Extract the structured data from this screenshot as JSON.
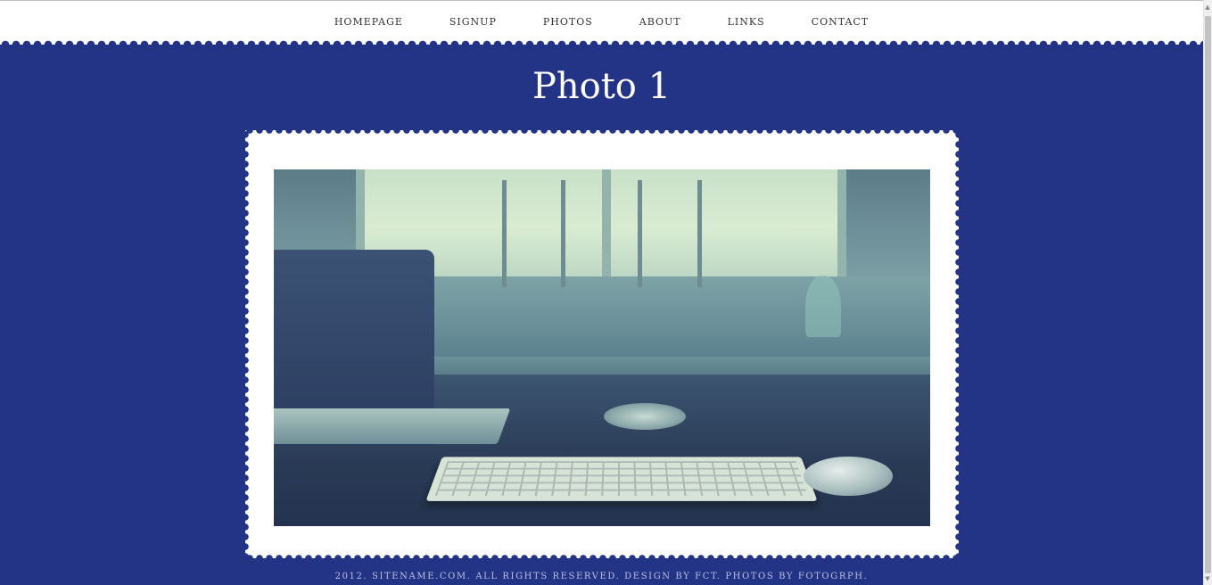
{
  "nav": {
    "items": [
      {
        "label": "HOMEPAGE"
      },
      {
        "label": "SIGNUP"
      },
      {
        "label": "PHOTOS"
      },
      {
        "label": "ABOUT"
      },
      {
        "label": "LINKS"
      },
      {
        "label": "CONTACT"
      }
    ]
  },
  "page": {
    "title": "Photo 1"
  },
  "photo": {
    "icon": "photo-image",
    "subject": "desk with laptop, keyboard and mouse"
  },
  "footer": {
    "prefix": "2012. SITENAME.COM. ALL RIGHTS RESERVED. DESIGN BY ",
    "design_link": "FCT",
    "middle": ". PHOTOS BY ",
    "photos_link": "FOTOGRPH",
    "suffix": "."
  },
  "colors": {
    "background": "#233385",
    "nav_background": "#ffffff",
    "nav_text": "#333333",
    "title_text": "#ffffff",
    "footer_text": "#b9c0de"
  }
}
